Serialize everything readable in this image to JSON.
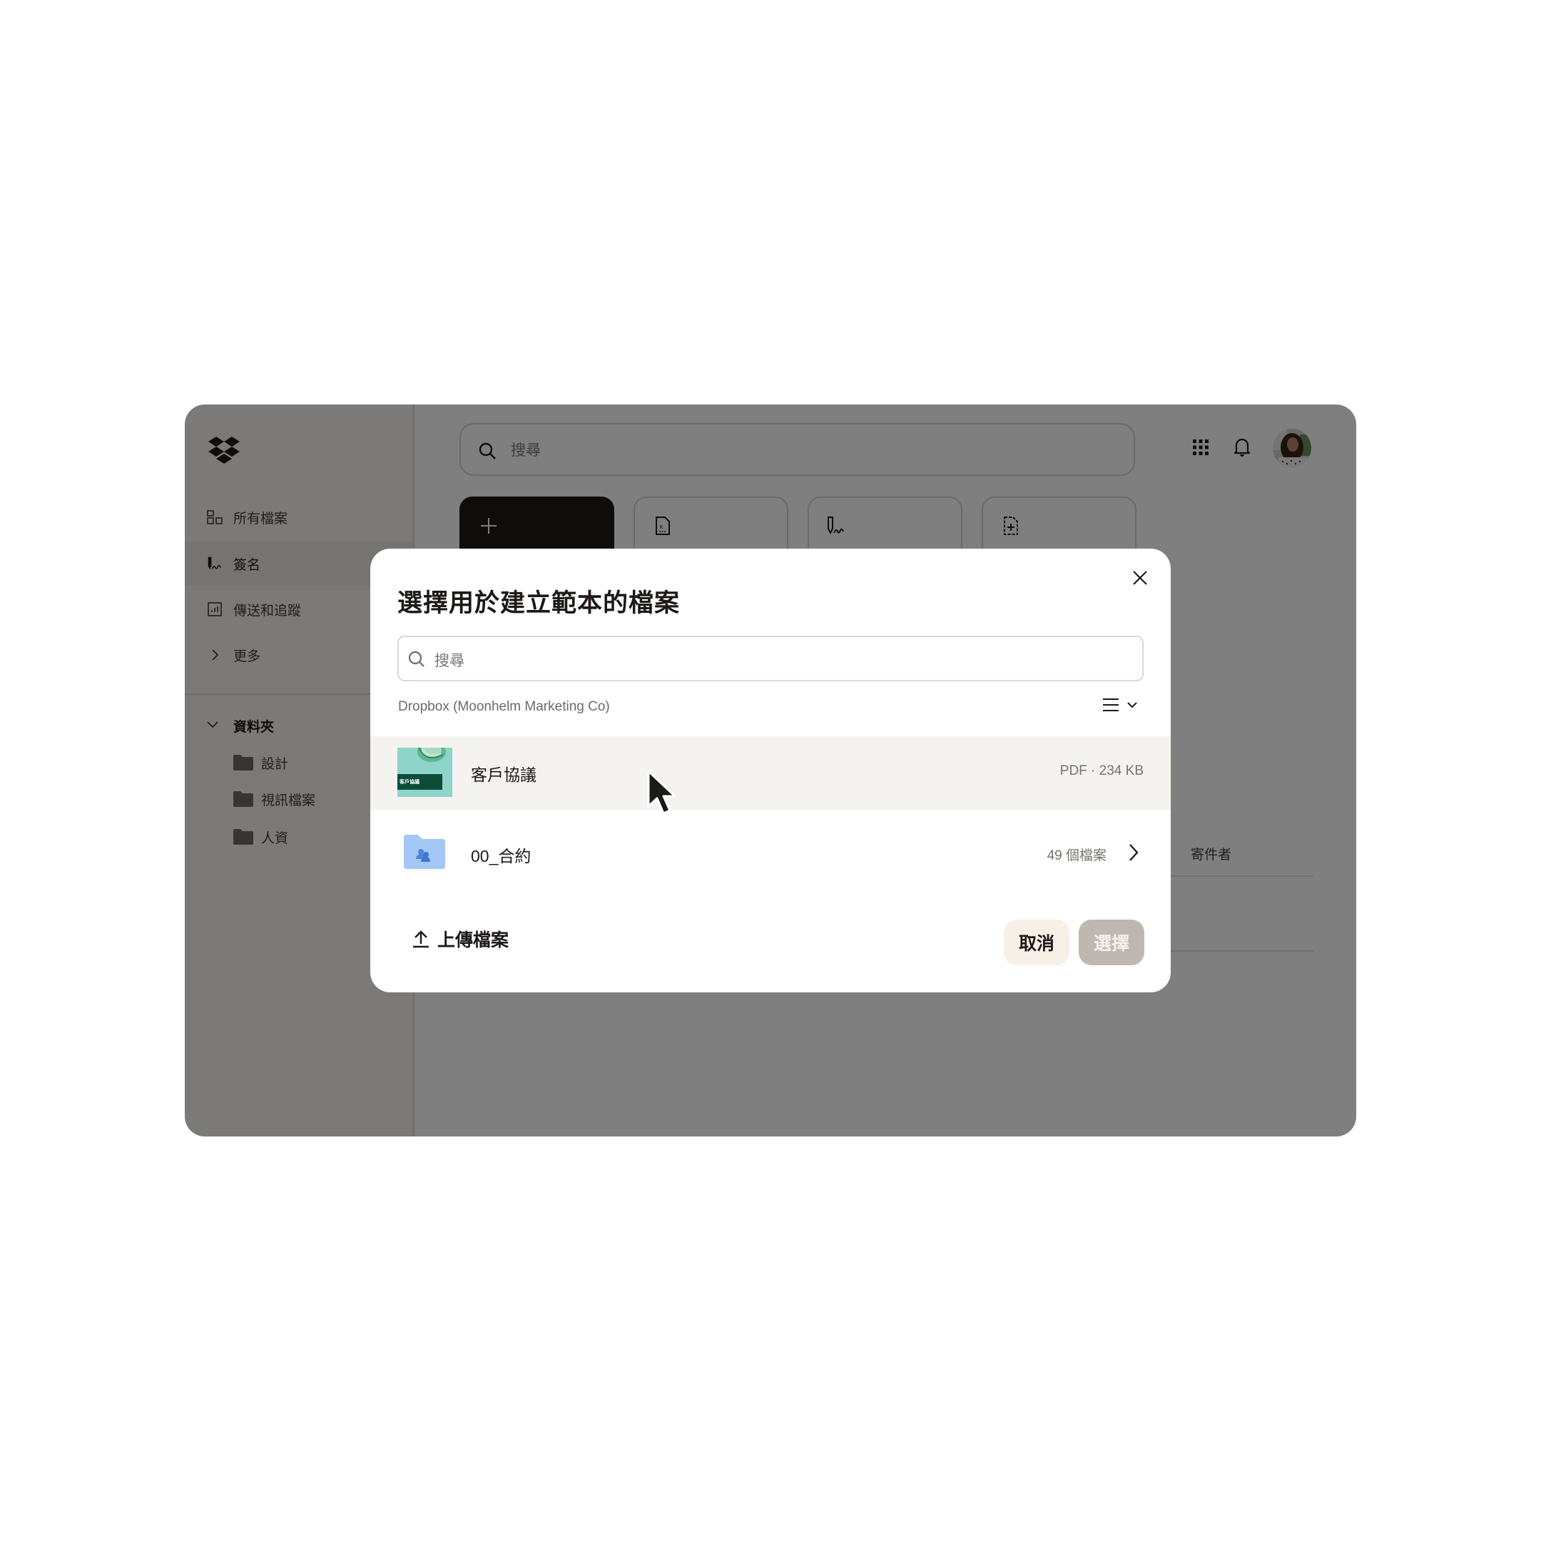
{
  "app": {
    "brand": "Dropbox",
    "sidebar": {
      "nav": [
        {
          "label": "所有檔案",
          "icon": "files-icon",
          "active": false
        },
        {
          "label": "簽名",
          "icon": "signature-icon",
          "active": true
        },
        {
          "label": "傳送和追蹤",
          "icon": "chart-icon",
          "active": false
        },
        {
          "label": "更多",
          "icon": "chevron-right-icon",
          "active": false
        }
      ],
      "folders_header": "資料夾",
      "folders": [
        {
          "label": "設計"
        },
        {
          "label": "視訊檔案"
        },
        {
          "label": "人資"
        }
      ]
    },
    "header": {
      "search_placeholder": "搜尋",
      "icons": [
        "app-grid-icon",
        "bell-icon",
        "avatar"
      ]
    },
    "actions": [
      {
        "icon": "plus-icon",
        "primary": true
      },
      {
        "icon": "document-x-icon",
        "primary": false
      },
      {
        "icon": "pen-signature-icon",
        "primary": false
      },
      {
        "icon": "document-plus-icon",
        "primary": false
      }
    ],
    "table": {
      "columns": [
        "寄件者"
      ]
    }
  },
  "modal": {
    "title": "選擇用於建立範本的檔案",
    "search_placeholder": "搜尋",
    "breadcrumb": "Dropbox (Moonhelm Marketing Co)",
    "items": [
      {
        "name": "客戶協議",
        "meta": "PDF · 234 KB",
        "type": "pdf",
        "thumb_label": "客戶協議",
        "highlighted": true
      },
      {
        "name": "00_合約",
        "meta": "49 個檔案",
        "type": "shared-folder",
        "highlighted": false
      }
    ],
    "upload_label": "上傳檔案",
    "cancel_label": "取消",
    "select_label": "選擇",
    "select_enabled": false
  },
  "colors": {
    "primary_dark": "#1e1919",
    "cancel_bg": "#f7f0e6",
    "select_disabled_bg": "#bfb8b0",
    "row_highlight": "#f5f3f0",
    "folder_blue": "#a3c8f5",
    "thumb_teal": "#8fd4ca",
    "thumb_green": "#0e4c3a"
  }
}
